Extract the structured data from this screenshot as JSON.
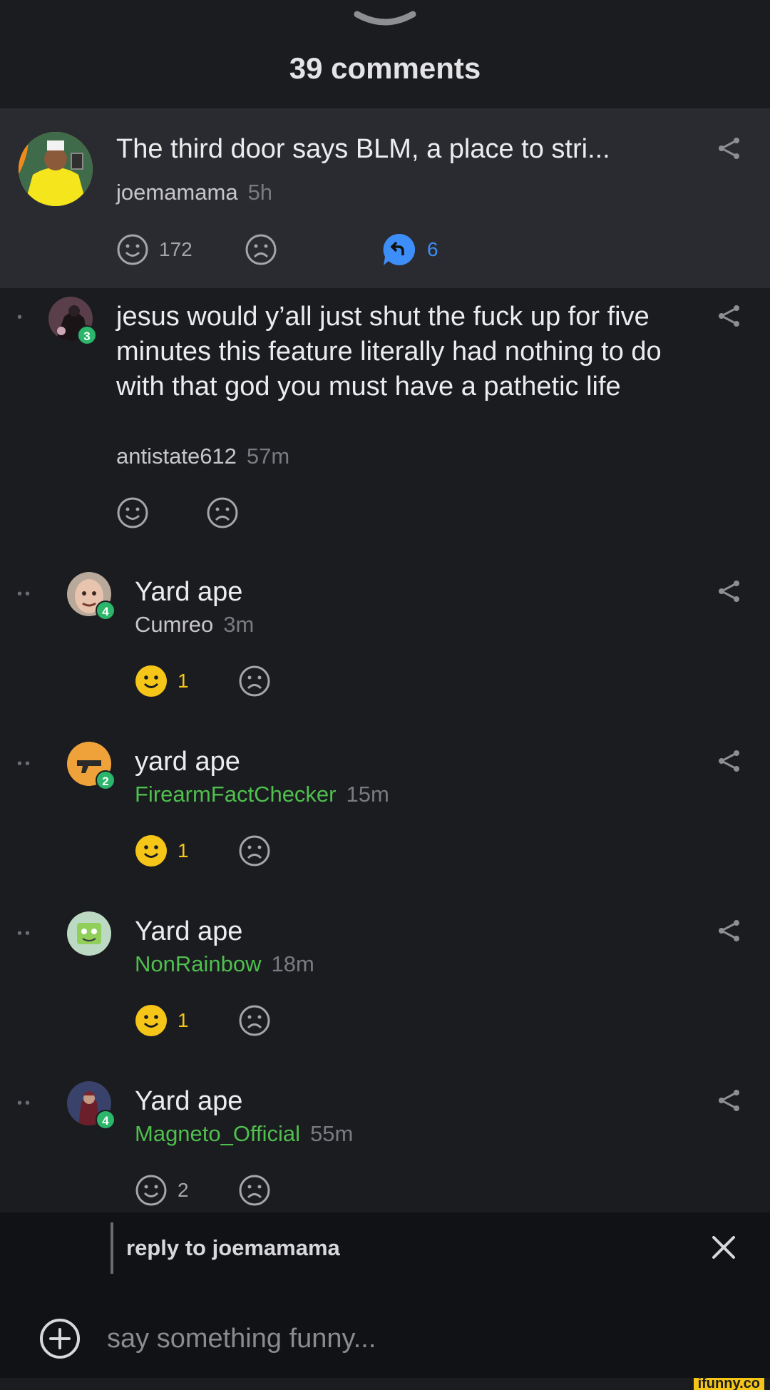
{
  "header": {
    "title": "39 comments"
  },
  "colors": {
    "accent_yellow": "#f5c518",
    "reply_blue": "#3d8ef8",
    "username_green": "#4fbf4e",
    "badge_green": "#2bb66b"
  },
  "comments": [
    {
      "text": "The third door says BLM, a place to stri...",
      "user": "joemamama",
      "time": "5h",
      "smile_count": "172",
      "reply_count": "6",
      "avatar": "yellow-suit-avatar"
    },
    {
      "text": "jesus would y’all just shut the fuck up for five minutes this feature literally had nothing to do with that god you must have a pathetic life",
      "user": "antistate612",
      "time": "57m",
      "badge": "3",
      "avatar": "dark-figure-avatar"
    },
    {
      "text": "Yard ape",
      "user": "Cumreo",
      "time": "3m",
      "badge": "4",
      "smile_count": "1",
      "avatar": "face-avatar"
    },
    {
      "text": "yard ape",
      "user": "FirearmFactChecker",
      "time": "15m",
      "badge": "2",
      "smile_count": "1",
      "avatar": "gun-avatar"
    },
    {
      "text": "Yard ape",
      "user": "NonRainbow",
      "time": "18m",
      "smile_count": "1",
      "avatar": "sponge-avatar"
    },
    {
      "text": "Yard ape",
      "user": "Magneto_Official",
      "time": "55m",
      "badge": "4",
      "smile_count": "2",
      "avatar": "magneto-avatar"
    }
  ],
  "reply_bar": {
    "label": "reply to joemamama",
    "placeholder": "say something funny..."
  },
  "watermark": "ifunny.co"
}
